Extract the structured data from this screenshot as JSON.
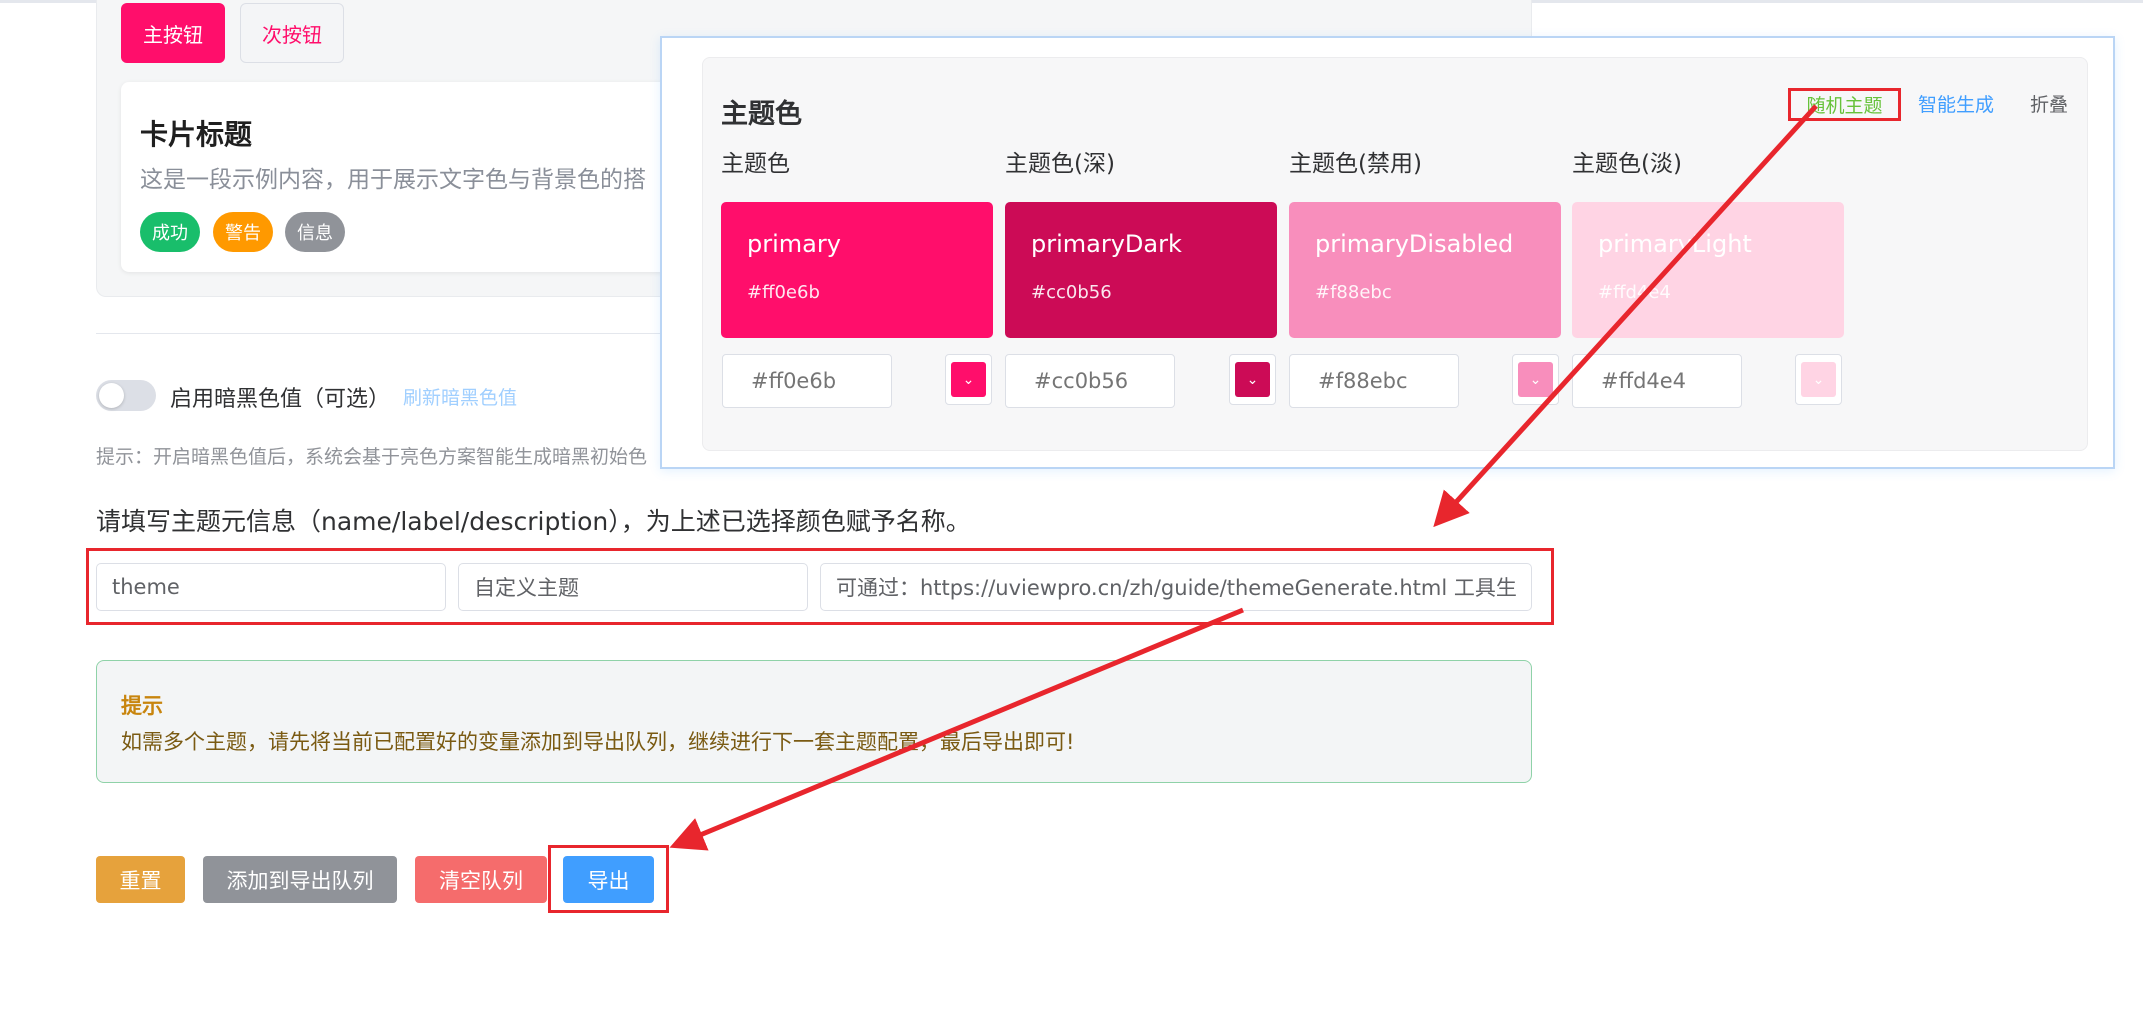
{
  "preview": {
    "primary_button": "主按钮",
    "secondary_button": "次按钮",
    "card_title": "卡片标题",
    "card_desc": "这是一段示例内容，用于展示文字色与背景色的搭",
    "tags": {
      "success": "成功",
      "warning": "警告",
      "info": "信息"
    }
  },
  "dark_mode": {
    "switch_label": "启用暗黑色值（可选）",
    "refresh_link": "刷新暗黑色值",
    "hint": "提示：开启暗黑色值后，系统会基于亮色方案智能生成暗黑初始色"
  },
  "meta": {
    "title": "请填写主题元信息（name/label/description），为上述已选择颜色赋予名称。",
    "name_value": "theme",
    "label_value": "自定义主题",
    "description_value": "可通过：https://uviewpro.cn/zh/guide/themeGenerate.html 工具生成"
  },
  "tip": {
    "title": "提示",
    "text": "如需多个主题，请先将当前已配置好的变量添加到导出队列，继续进行下一套主题配置，最后导出即可!"
  },
  "actions": {
    "reset": "重置",
    "add_to_queue": "添加到导出队列",
    "clear_queue": "清空队列",
    "export": "导出"
  },
  "theme_panel": {
    "heading": "主题色",
    "random_theme": "随机主题",
    "smart_generate": "智能生成",
    "fold": "折叠",
    "colors": [
      {
        "label": "主题色",
        "name": "primary",
        "hex": "#ff0e6b",
        "placeholder": "#ff0e6b"
      },
      {
        "label": "主题色(深)",
        "name": "primaryDark",
        "hex": "#cc0b56",
        "placeholder": "#cc0b56"
      },
      {
        "label": "主题色(禁用)",
        "name": "primaryDisabled",
        "hex": "#f88ebc",
        "placeholder": "#f88ebc"
      },
      {
        "label": "主题色(淡)",
        "name": "primaryLight",
        "hex": "#ffd4e4",
        "placeholder": "#ffd4e4"
      }
    ]
  },
  "colors": {
    "annotation_red": "#e8262d",
    "success": "#19be6b",
    "warning": "#ff9900",
    "info": "#909399",
    "link_blue": "#409eff"
  }
}
